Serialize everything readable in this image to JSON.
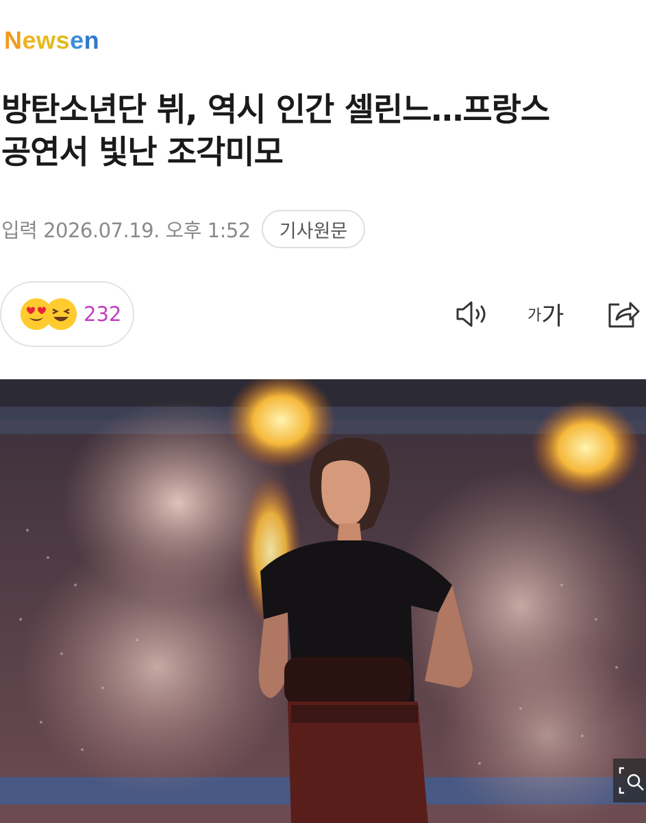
{
  "brand": {
    "logo_parts": [
      "N",
      "e",
      "w",
      "s",
      "e",
      "n"
    ],
    "colors": {
      "orange": "#f39a1f",
      "yellow": "#f0b323",
      "blue": "#2f79c9"
    }
  },
  "article": {
    "headline_line1": "방탄소년단 뷔, 역시 인간 셀린느…프랑스",
    "headline_line2": "공연서 빛난 조각미모",
    "date": "입력 2026.07.19. 오후 1:52",
    "source_button": "기사원문"
  },
  "reactions": {
    "icons": [
      "heart-eyes-emoji-icon",
      "laughing-emoji-icon"
    ],
    "count": "232",
    "count_color": "#c13ec1"
  },
  "toolbar": {
    "listen_icon": "speaker-icon",
    "font_size_small": "가",
    "font_size_big": "가",
    "share_icon": "share-icon"
  },
  "photo": {
    "icon": "zoom-search-icon"
  }
}
